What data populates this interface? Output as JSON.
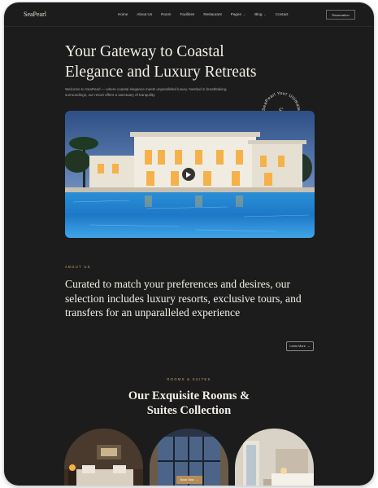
{
  "nav": {
    "logo": "SeaPearl",
    "items": [
      {
        "label": "Home",
        "active": false,
        "dropdown": false
      },
      {
        "label": "About Us",
        "active": true,
        "dropdown": false
      },
      {
        "label": "Room",
        "active": false,
        "dropdown": false
      },
      {
        "label": "Facilities",
        "active": false,
        "dropdown": false
      },
      {
        "label": "Restaurant",
        "active": false,
        "dropdown": false
      },
      {
        "label": "Pages",
        "active": false,
        "dropdown": true
      },
      {
        "label": "Blog",
        "active": false,
        "dropdown": true
      },
      {
        "label": "Contact",
        "active": false,
        "dropdown": false
      }
    ],
    "reserve_label": "Reservation"
  },
  "hero": {
    "title_line1": "Your Gateway to Coastal",
    "title_line2": "Elegance and Luxury Retreats",
    "description": "Welcome to SeaPearl — where coastal elegance meets unparalleled luxury. Nestled in breathtaking surroundings, our resort offers a sanctuary of tranquility.",
    "badge_text": "SeaPearl Your Ultimate Destination",
    "badge_letter": "S"
  },
  "about": {
    "label": "ABOUT US",
    "text": "Curated to match your preferences and desires, our selection includes luxury resorts, exclusive tours, and transfers for an unparalleled experience",
    "button_label": "Learn More"
  },
  "rooms": {
    "label": "ROOMS & SUITES",
    "title_line1": "Our Exquisite Rooms &",
    "title_line2": "Suites Collection",
    "book_label": "Book Now"
  },
  "colors": {
    "background": "#1c1c1c",
    "accent": "#c9a46a",
    "text": "#f3efe8"
  },
  "icons": {
    "play": "play-icon",
    "arrow": "arrow-right-icon",
    "chevron": "chevron-down-icon"
  }
}
